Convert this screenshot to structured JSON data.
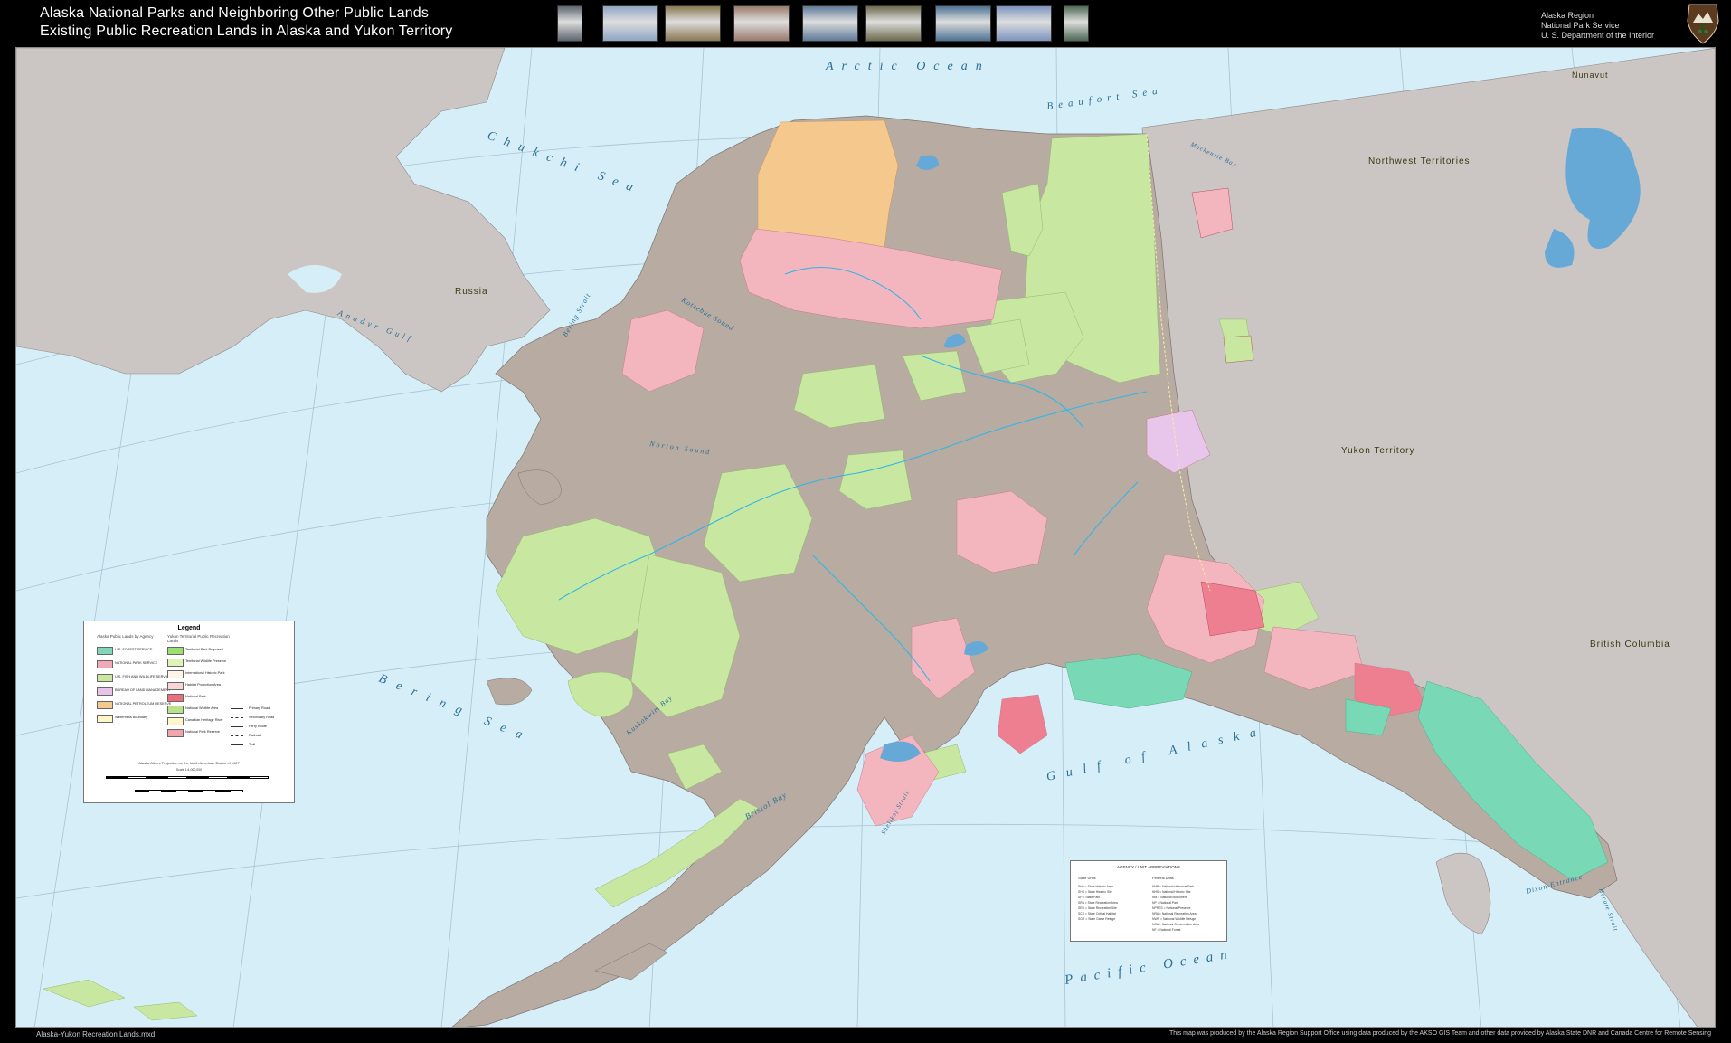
{
  "header": {
    "title_line1": "Alaska National Parks and Neighboring Other Public Lands",
    "title_line2": "Existing Public Recreation Lands in Alaska and Yukon Territory",
    "agency_lines": [
      "Alaska Region",
      "National Park Service",
      "U. S. Department of the Interior"
    ],
    "photo_count": 9,
    "photo_colors": [
      "#5d6670",
      "#8fa6c4",
      "#8a7a52",
      "#9a7b6c",
      "#5f7a98",
      "#6d6b4e",
      "#4d7393",
      "#7d94bf",
      "#4e6a55"
    ]
  },
  "map": {
    "ocean_labels": {
      "arctic_ocean": "Arctic Ocean",
      "chukchi_sea": "Chukchi Sea",
      "beaufort_sea": "Beaufort Sea",
      "bering_sea": "Bering Sea",
      "gulf_of_alaska": "Gulf of Alaska",
      "pacific_ocean": "Pacific Ocean",
      "anadyr_gulf": "Anadyr Gulf",
      "norton_sound": "Norton Sound",
      "kotzebue_sound": "Kotzebue Sound",
      "bering_strait": "Bering Strait",
      "bristol_bay": "Bristol Bay",
      "kuskokwim_bay": "Kuskokwim Bay",
      "shelikof_strait": "Shelikof Strait",
      "dixon_entrance": "Dixon Entrance",
      "hecate_strait": "Hecate Strait",
      "mackenzie_bay": "Mackenzie Bay"
    },
    "region_labels": {
      "russia": "Russia",
      "northwest_territories": "Northwest Territories",
      "yukon_territory": "Yukon Territory",
      "british_columbia": "British Columbia",
      "nunavut": "Nunavut"
    },
    "colors": {
      "ocean": "#d6eef8",
      "land_other": "#cbc5c3",
      "alaska_land": "#b7aba2",
      "nps": "#f3b6bf",
      "nps_strong": "#ee7f91",
      "usfws": "#c8e8a2",
      "npra": "#f5c98d",
      "forest": "#79d9b6",
      "water": "#66a9d7",
      "rivers": "#33b5e6"
    }
  },
  "legend": {
    "title": "Legend",
    "col1_head": "Alaska Public Lands by Agency",
    "col2_head": "Yukon Territorial Public Recreation Lands",
    "col1_items": [
      {
        "label": "U.S. FOREST SERVICE",
        "color": "#7fd7b8"
      },
      {
        "label": "NATIONAL PARK SERVICE",
        "color": "#f3a8b6"
      },
      {
        "label": "U.S. FISH AND WILDLIFE SERVICE",
        "color": "#c8e8a2"
      },
      {
        "label": "BUREAU OF LAND MANAGEMENT",
        "color": "#e7c5ea"
      },
      {
        "label": "NATIONAL PETROLEUM RESERVE",
        "color": "#f5c98d"
      },
      {
        "label": "Wilderness Boundary",
        "color": "#fdf7c8"
      }
    ],
    "col2_items": [
      {
        "label": "Territorial Park Proposed",
        "color": "#9be06e"
      },
      {
        "label": "Territorial Wildlife Preserve",
        "color": "#dff2b7"
      },
      {
        "label": "International Historic Park",
        "color": "#fff4e8"
      },
      {
        "label": "Habitat Protection Area",
        "color": "#f8d6d6"
      },
      {
        "label": "National Park",
        "color": "#ee6d7d"
      },
      {
        "label": "National Wildlife Area",
        "color": "#b9e38a"
      },
      {
        "label": "Canadian Heritage River",
        "color": "#fff6c9"
      },
      {
        "label": "National Park Reserve",
        "color": "#f0a5ad"
      }
    ],
    "line_items": [
      "Primary Road",
      "Secondary Road",
      "Ferry Route",
      "Railroad",
      "Trail"
    ],
    "projection_text": "Alaska Albers Projection on the North American Datum of 1927",
    "scale_label": "Scale 1:4,000,000"
  },
  "abbreviations": {
    "title": "AGENCY / UNIT ABBREVIATIONS",
    "col1_head": "State Units",
    "col2_head": "Federal Units",
    "col1_rows": [
      "SHA = State Historic Area",
      "SHS = State Historic Site",
      "SP = State Park",
      "SRA = State Recreation Area",
      "SRS = State Recreation Site",
      "SCS = State Critical Habitat",
      "SGR = State Game Refuge"
    ],
    "col2_rows": [
      "NHP = National Historical Park",
      "NHS = National Historic Site",
      "NM = National Monument",
      "NP = National Park",
      "NPRES = National Preserve",
      "NRA = National Recreation Area",
      "NWR = National Wildlife Refuge",
      "NCA = National Conservation Area",
      "NF = National Forest"
    ]
  },
  "footer": {
    "left": "Alaska-Yukon Recreation Lands.mxd",
    "right": "This map was produced by the Alaska Region Support Office using data produced by the AKSO GIS Team and other data provided by Alaska State DNR and Canada Centre for Remote Sensing"
  }
}
